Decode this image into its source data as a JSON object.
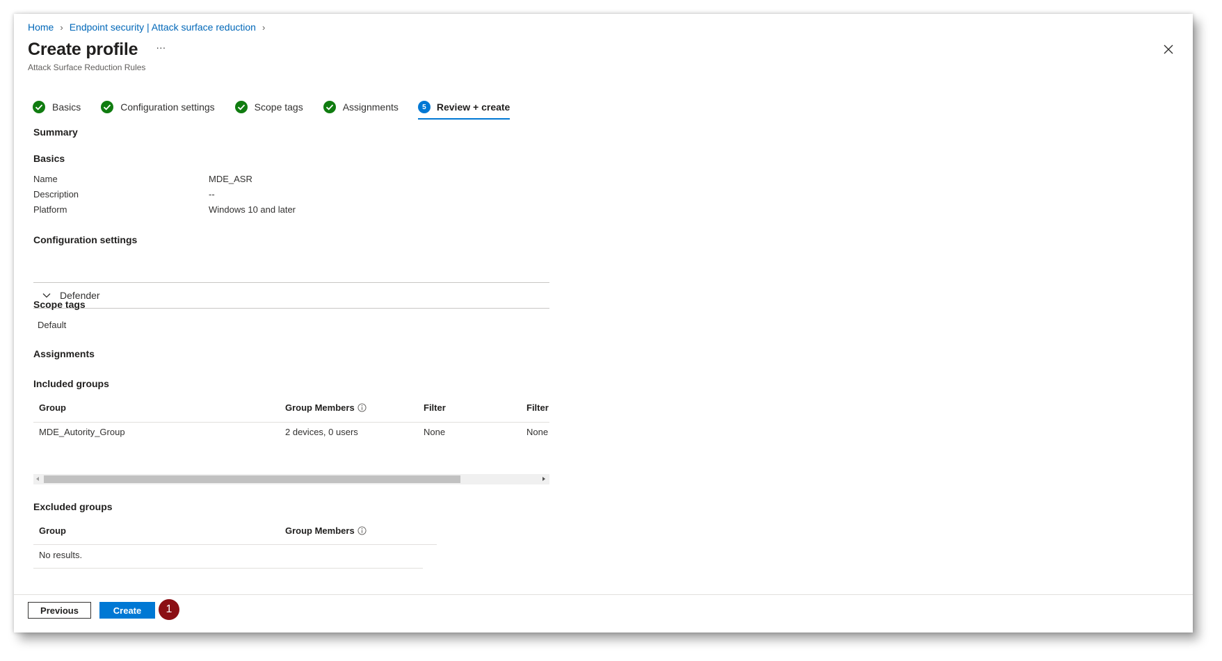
{
  "breadcrumb": [
    {
      "label": "Home"
    },
    {
      "label": "Endpoint security | Attack surface reduction"
    }
  ],
  "header": {
    "title": "Create profile",
    "more": "···",
    "subtitle": "Attack Surface Reduction Rules"
  },
  "steps": [
    {
      "label": "Basics",
      "state": "done"
    },
    {
      "label": "Configuration settings",
      "state": "done"
    },
    {
      "label": "Scope tags",
      "state": "done"
    },
    {
      "label": "Assignments",
      "state": "done"
    },
    {
      "label": "Review + create",
      "state": "active",
      "number": "5"
    }
  ],
  "summary": {
    "heading": "Summary",
    "basics": {
      "heading": "Basics",
      "rows": [
        {
          "label": "Name",
          "value": "MDE_ASR"
        },
        {
          "label": "Description",
          "value": "--"
        },
        {
          "label": "Platform",
          "value": "Windows 10 and later"
        }
      ]
    },
    "config": {
      "heading": "Configuration settings",
      "accordion_label": "Defender"
    },
    "scope": {
      "heading": "Scope tags",
      "value": "Default"
    },
    "assignments": {
      "heading": "Assignments",
      "included": {
        "heading": "Included groups",
        "columns": [
          "Group",
          "Group Members",
          "Filter",
          "Filter"
        ],
        "rows": [
          [
            "MDE_Autority_Group",
            "2 devices, 0 users",
            "None",
            "None"
          ]
        ]
      },
      "excluded": {
        "heading": "Excluded groups",
        "columns": [
          "Group",
          "Group Members"
        ],
        "empty_text": "No results."
      }
    }
  },
  "footer": {
    "previous_label": "Previous",
    "create_label": "Create",
    "callout_number": "1"
  },
  "colors": {
    "accent": "#0078d4",
    "link": "#0067b8",
    "success": "#107c10",
    "callout": "#8b0f14"
  }
}
